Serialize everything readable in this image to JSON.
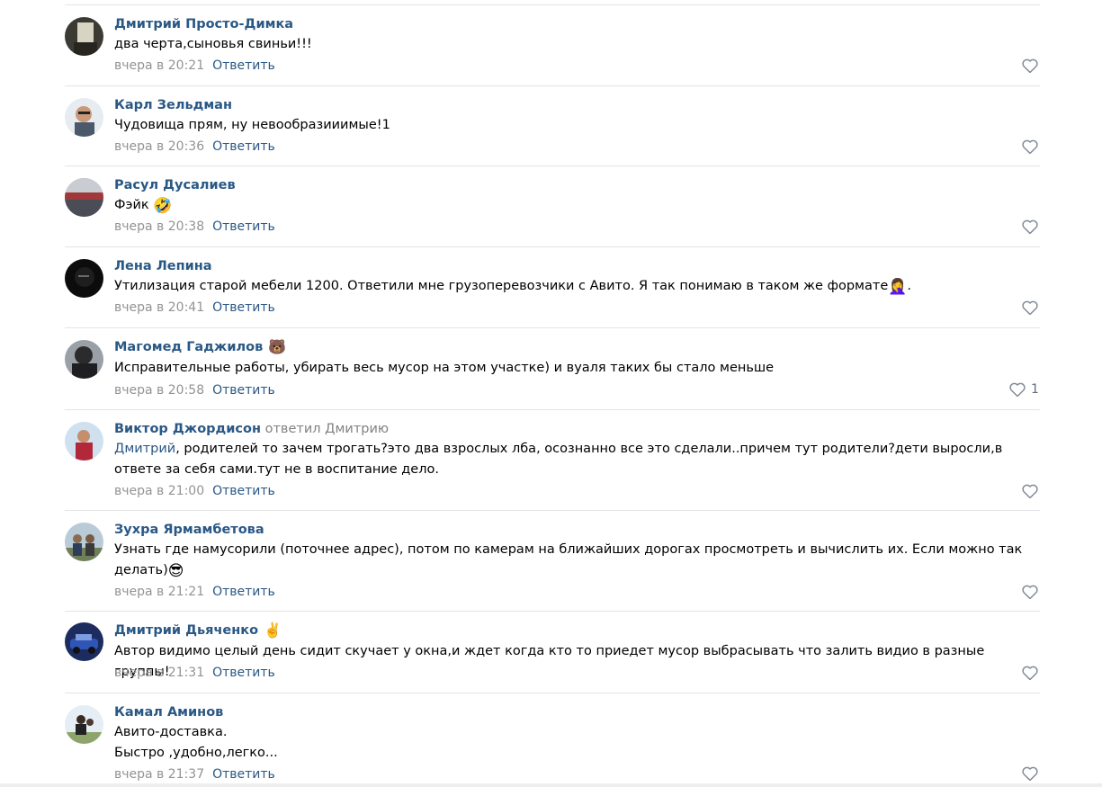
{
  "comments": [
    {
      "author": "Дмитрий Просто-Димка",
      "text": "два черта,сыновья свиньи!!!",
      "time": "вчера в 20:21",
      "reply_label": "Ответить",
      "avatar_icon": "avatar-photo"
    },
    {
      "author": "Карл Зельдман",
      "text": "Чудовища прям, ну невообразииимые!1",
      "time": "вчера в 20:36",
      "reply_label": "Ответить",
      "avatar_icon": "avatar-photo"
    },
    {
      "author": "Расул Дусалиев",
      "text": "Фэйк",
      "emoji": "🤣",
      "time": "вчера в 20:38",
      "reply_label": "Ответить",
      "avatar_icon": "avatar-photo"
    },
    {
      "author": "Лена Лепина",
      "text": "Утилизация старой мебели 1200. Ответили мне грузоперевозчики с Авито. Я так понимаю в таком же формате",
      "emoji": "🤦‍♀️",
      "text_after": ".",
      "time": "вчера в 20:41",
      "reply_label": "Ответить",
      "avatar_icon": "avatar-photo"
    },
    {
      "author": "Магомед Гаджилов",
      "author_badge": "🐻",
      "text": "Исправительные работы, убирать весь мусор на этом участке) и вуаля таких бы стало меньше",
      "time": "вчера в 20:58",
      "reply_label": "Ответить",
      "like_count": "1",
      "avatar_icon": "avatar-photo"
    },
    {
      "author": "Виктор Джордисон",
      "replied_to": "ответил Дмитрию",
      "mention": "Дмитрий",
      "text": ", родителей то зачем трогать?это два взрослых лба, осознанно все это сделали..причем тут родители?дети выросли,в ответе за себя сами.тут не в воспитание дело.",
      "time": "вчера в 21:00",
      "reply_label": "Ответить",
      "avatar_icon": "avatar-photo"
    },
    {
      "author": "Зухра Ярмамбетова",
      "text": "Узнать где намусорили (поточнее адрес), потом по камерам на ближайших дорогах просмотреть и вычислить их. Если можно так делать)",
      "emoji": "😎",
      "time": "вчера в 21:21",
      "reply_label": "Ответить",
      "avatar_icon": "avatar-photo"
    },
    {
      "author": "Дмитрий Дьяченко",
      "author_badge": "✌️",
      "text": "Автор видимо целый день сидит скучает у окна,и ждет когда кто то приедет мусор выбрасывать что залить видио в разные группы!",
      "time": "вчера в 21:31",
      "reply_label": "Ответить",
      "avatar_icon": "avatar-photo"
    },
    {
      "author": "Камал Аминов",
      "text_line1": "Авито-доставка.",
      "text_line2": "Быстро ,удобно,легко...",
      "time": "вчера в 21:37",
      "reply_label": "Ответить",
      "avatar_icon": "avatar-photo"
    }
  ],
  "icons": {
    "like": "heart-outline-icon"
  },
  "colors": {
    "author_link": "#2a5885",
    "meta_gray": "#939393",
    "separator": "#e3e4e8"
  }
}
